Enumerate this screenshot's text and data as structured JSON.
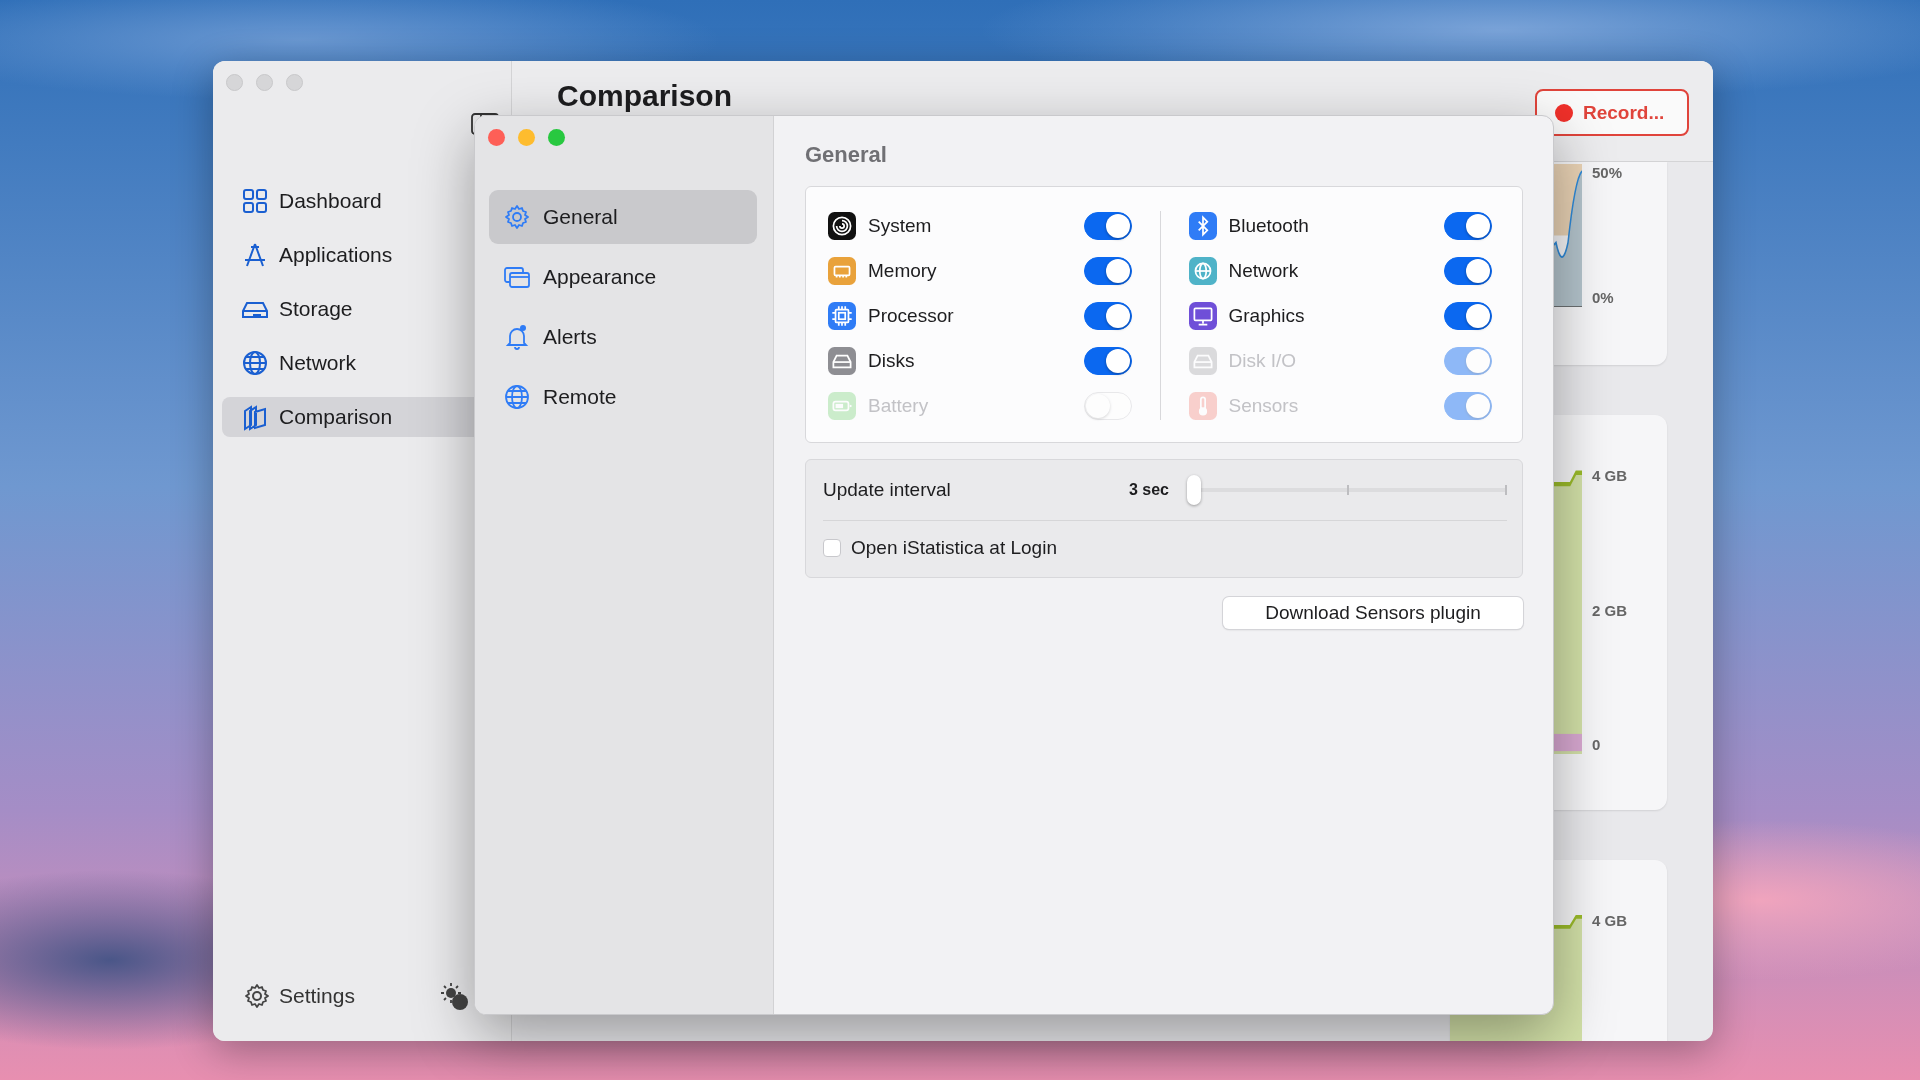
{
  "main_window": {
    "sidebar": {
      "items": [
        {
          "label": "Dashboard",
          "selected": false
        },
        {
          "label": "Applications",
          "selected": false
        },
        {
          "label": "Storage",
          "selected": false
        },
        {
          "label": "Network",
          "selected": false
        },
        {
          "label": "Comparison",
          "selected": true
        }
      ],
      "settings_label": "Settings"
    },
    "title": "Comparison",
    "record_button": "Record...",
    "cards": [
      {
        "axis_labels": [
          "50%",
          "0%"
        ]
      },
      {
        "axis_labels": [
          "4 GB",
          "2 GB",
          "0"
        ]
      },
      {
        "axis_labels": [
          "4 GB"
        ]
      }
    ]
  },
  "settings_window": {
    "sidebar": {
      "items": [
        {
          "label": "General",
          "selected": true
        },
        {
          "label": "Appearance",
          "selected": false
        },
        {
          "label": "Alerts",
          "selected": false
        },
        {
          "label": "Remote",
          "selected": false
        }
      ]
    },
    "heading": "General",
    "modules": {
      "left": [
        {
          "label": "System",
          "on": true,
          "disabled": false
        },
        {
          "label": "Memory",
          "on": true,
          "disabled": false
        },
        {
          "label": "Processor",
          "on": true,
          "disabled": false
        },
        {
          "label": "Disks",
          "on": true,
          "disabled": false
        },
        {
          "label": "Battery",
          "on": false,
          "disabled": true
        }
      ],
      "right": [
        {
          "label": "Bluetooth",
          "on": true,
          "disabled": false
        },
        {
          "label": "Network",
          "on": true,
          "disabled": false
        },
        {
          "label": "Graphics",
          "on": true,
          "disabled": false
        },
        {
          "label": "Disk I/O",
          "on": true,
          "disabled": true
        },
        {
          "label": "Sensors",
          "on": true,
          "disabled": true
        }
      ]
    },
    "update_interval": {
      "label": "Update interval",
      "reading": "3 sec",
      "level": 0
    },
    "login_item": {
      "label": "Open iStatistica at Login",
      "checked": false
    },
    "download_button": "Download Sensors plugin"
  }
}
